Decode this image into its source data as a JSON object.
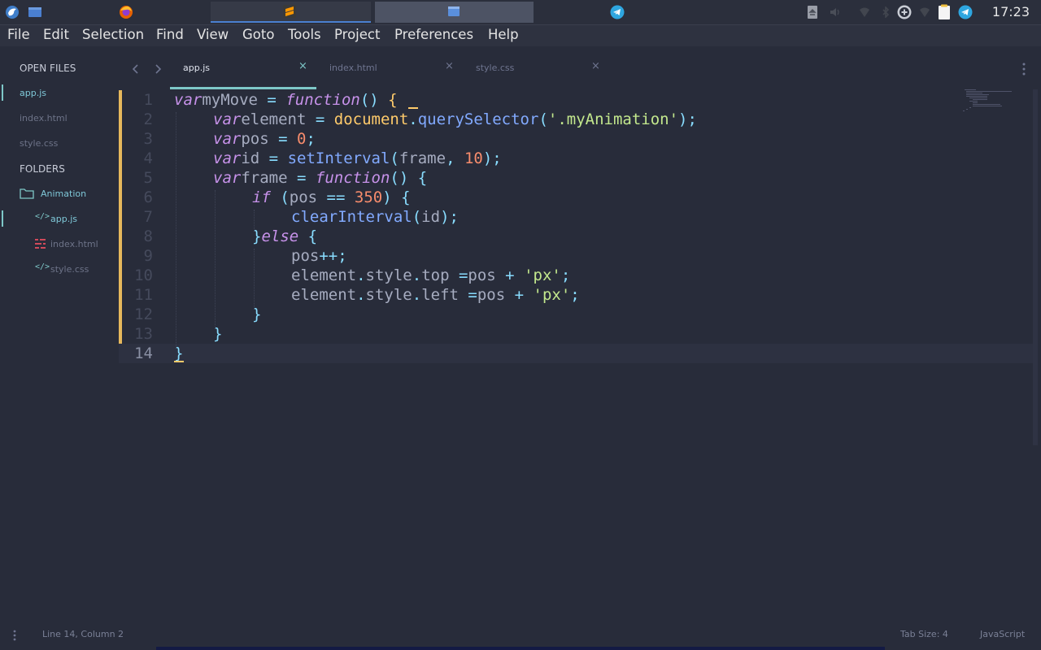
{
  "panel": {
    "clock": "17:23",
    "colors": {
      "telegram": "#2ea6e0",
      "firefox": "#e66000",
      "sublime": "#ff9800"
    }
  },
  "menubar": {
    "items": [
      "File",
      "Edit",
      "Selection",
      "Find",
      "View",
      "Goto",
      "Tools",
      "Project",
      "Preferences",
      "Help"
    ]
  },
  "sidebar": {
    "open_files_label": "OPEN FILES",
    "open_files": [
      "app.js",
      "index.html",
      "style.css"
    ],
    "folders_label": "FOLDERS",
    "folder_name": "Animation",
    "folder_files": [
      "app.js",
      "index.html",
      "style.css"
    ]
  },
  "tabs": [
    {
      "label": "app.js"
    },
    {
      "label": "index.html"
    },
    {
      "label": "style.css"
    }
  ],
  "tab_close_glyph": "×",
  "code": {
    "line_numbers": [
      "1",
      "2",
      "3",
      "4",
      "5",
      "6",
      "7",
      "8",
      "9",
      "10",
      "11",
      "12",
      "13",
      "14"
    ],
    "tokens": [
      [
        [
          "kw",
          "var"
        ],
        [
          "",
          "myMove "
        ],
        [
          "op",
          "="
        ],
        [
          "",
          " "
        ],
        [
          "kw",
          "function"
        ],
        [
          "op",
          "() "
        ],
        [
          "gl",
          "{"
        ]
      ],
      [
        [
          "",
          " "
        ],
        [
          "kw",
          "var"
        ],
        [
          "",
          "element "
        ],
        [
          "op",
          "="
        ],
        [
          "",
          " "
        ],
        [
          "gl",
          "document"
        ],
        [
          "op",
          "."
        ],
        [
          "fn",
          "querySelector"
        ],
        [
          "op",
          "("
        ],
        [
          "str",
          "'.myAnimation'"
        ],
        [
          "op",
          ");"
        ]
      ],
      [
        [
          "",
          " "
        ],
        [
          "kw",
          "var"
        ],
        [
          "",
          "pos "
        ],
        [
          "op",
          "="
        ],
        [
          "",
          " "
        ],
        [
          "num",
          "0"
        ],
        [
          "op",
          ";"
        ]
      ],
      [
        [
          "",
          " "
        ],
        [
          "kw",
          "var"
        ],
        [
          "",
          "id "
        ],
        [
          "op",
          "="
        ],
        [
          "",
          " "
        ],
        [
          "fn",
          "setInterval"
        ],
        [
          "op",
          "("
        ],
        [
          "",
          "frame"
        ],
        [
          "op",
          ", "
        ],
        [
          "num",
          "10"
        ],
        [
          "op",
          ");"
        ]
      ],
      [
        [
          "",
          " "
        ],
        [
          "kw",
          "var"
        ],
        [
          "",
          "frame "
        ],
        [
          "op",
          "="
        ],
        [
          "",
          " "
        ],
        [
          "kw",
          "function"
        ],
        [
          "op",
          "() {"
        ]
      ],
      [
        [
          "",
          " "
        ],
        [
          "kw",
          "if"
        ],
        [
          "op",
          " ("
        ],
        [
          "",
          "pos "
        ],
        [
          "op",
          "=="
        ],
        [
          "",
          " "
        ],
        [
          "num",
          "350"
        ],
        [
          "op",
          ") {"
        ]
      ],
      [
        [
          "",
          " "
        ],
        [
          "fn",
          "clearInterval"
        ],
        [
          "op",
          "("
        ],
        [
          "",
          "id"
        ],
        [
          "op",
          ");"
        ]
      ],
      [
        [
          "",
          " "
        ],
        [
          "op",
          "}"
        ],
        [
          "kw",
          "else"
        ],
        [
          "op",
          " {"
        ]
      ],
      [
        [
          "",
          " "
        ],
        [
          "",
          "pos"
        ],
        [
          "op",
          "++;"
        ]
      ],
      [
        [
          "",
          " "
        ],
        [
          "",
          "element"
        ],
        [
          "op",
          "."
        ],
        [
          "",
          "style"
        ],
        [
          "op",
          "."
        ],
        [
          "",
          "top "
        ],
        [
          "op",
          "="
        ],
        [
          "",
          "pos "
        ],
        [
          "op",
          "+"
        ],
        [
          "",
          " "
        ],
        [
          "str",
          "'px'"
        ],
        [
          "op",
          ";"
        ]
      ],
      [
        [
          "",
          " "
        ],
        [
          "",
          "element"
        ],
        [
          "op",
          "."
        ],
        [
          "",
          "style"
        ],
        [
          "op",
          "."
        ],
        [
          "",
          "left "
        ],
        [
          "op",
          "="
        ],
        [
          "",
          "pos "
        ],
        [
          "op",
          "+"
        ],
        [
          "",
          " "
        ],
        [
          "str",
          "'px'"
        ],
        [
          "op",
          ";"
        ]
      ],
      [
        [
          "",
          " "
        ],
        [
          "op",
          "}"
        ]
      ],
      [
        [
          "",
          " "
        ],
        [
          "op",
          "}"
        ]
      ],
      [
        [
          "op",
          "}"
        ]
      ]
    ]
  },
  "status": {
    "position": "Line 14, Column 2",
    "tab_size": "Tab Size: 4",
    "syntax": "JavaScript"
  },
  "icons": {
    "back": "chevron-left-icon",
    "forward": "chevron-right-icon",
    "overflow": "more-vertical-icon"
  }
}
